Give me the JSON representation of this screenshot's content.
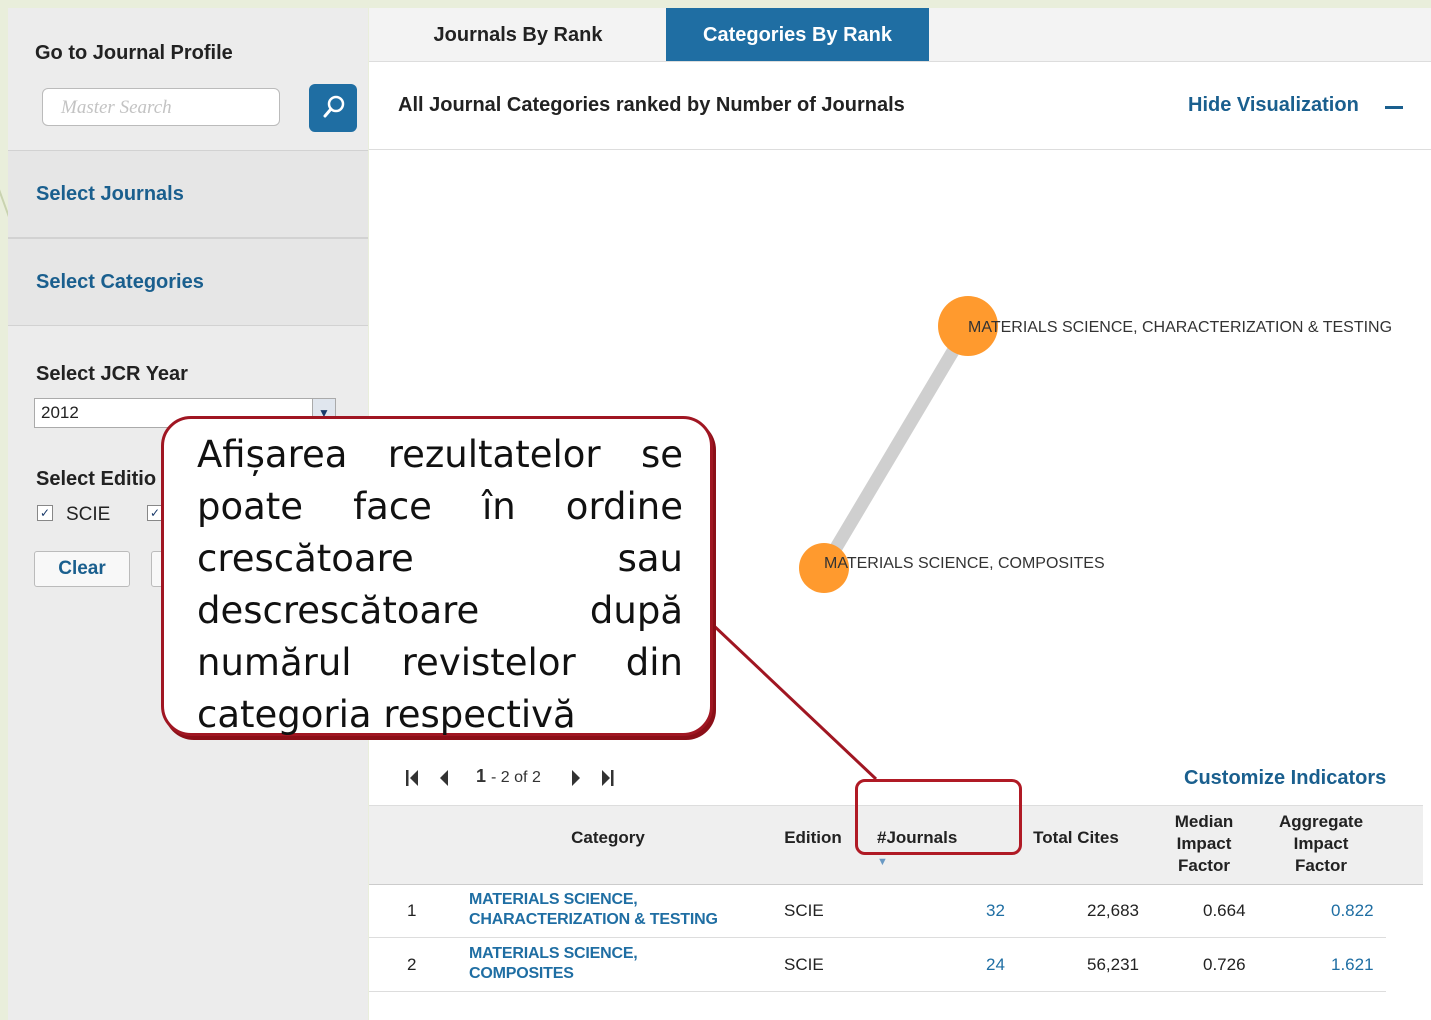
{
  "sidebar": {
    "title": "Go to Journal Profile",
    "search_placeholder": "Master Search",
    "select_journals": "Select Journals",
    "select_categories": "Select Categories",
    "jcr_year_label": "Select JCR Year",
    "jcr_year_value": "2012",
    "edition_label": "Select Editio",
    "edition_scie": "SCIE",
    "clear_label": "Clear"
  },
  "tabs": [
    {
      "label": "Journals By Rank",
      "active": false
    },
    {
      "label": "Categories By Rank",
      "active": true
    }
  ],
  "viz": {
    "title": "All Journal Categories ranked by Number of Journals",
    "hide_label": "Hide Visualization",
    "nodes": [
      {
        "label": "MATERIALS SCIENCE, CHARACTERIZATION & TESTING"
      },
      {
        "label": "MATERIALS SCIENCE, COMPOSITES"
      }
    ]
  },
  "pager": {
    "range_start": "1",
    "range_rest": "- 2 of 2"
  },
  "customize_label": "Customize Indicators",
  "table": {
    "headers": {
      "category": "Category",
      "edition": "Edition",
      "journals": "#Journals",
      "total_cites": "Total Cites",
      "median_l1": "Median",
      "median_l2": "Impact",
      "median_l3": "Factor",
      "aggregate_l1": "Aggregate",
      "aggregate_l2": "Impact",
      "aggregate_l3": "Factor"
    },
    "rows": [
      {
        "rank": "1",
        "cat_l1": "MATERIALS SCIENCE,",
        "cat_l2": "CHARACTERIZATION & TESTING",
        "edition": "SCIE",
        "journals": "32",
        "total_cites": "22,683",
        "median_if": "0.664",
        "aggregate_if": "0.822"
      },
      {
        "rank": "2",
        "cat_l1": "MATERIALS SCIENCE,",
        "cat_l2": "COMPOSITES",
        "edition": "SCIE",
        "journals": "24",
        "total_cites": "56,231",
        "median_if": "0.726",
        "aggregate_if": "1.621"
      }
    ]
  },
  "callout": {
    "text": "Afișarea rezultatelor se poate face în ordine crescătoare sau descrescătoare după numărul revistelor din categoria respectivă"
  },
  "colors": {
    "accent_blue": "#1f6ea3",
    "node_orange": "#ff9a2e",
    "callout_border": "#a01622"
  }
}
